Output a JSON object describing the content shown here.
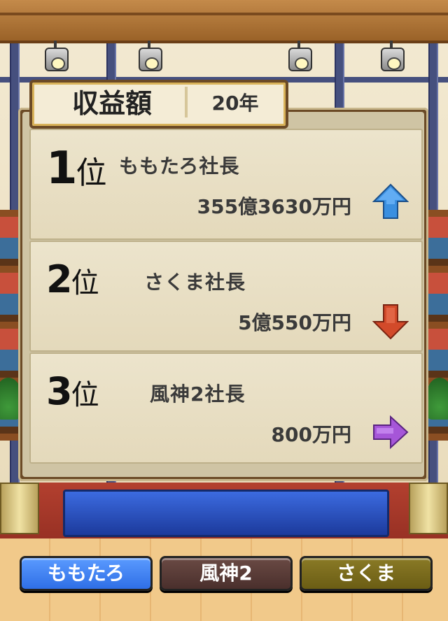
{
  "title": {
    "label": "収益額",
    "period": "20年"
  },
  "rankings": [
    {
      "rank": "1",
      "rank_suffix": "位",
      "name": "ももたろ社長",
      "amount": "355億3630万円",
      "trend": "up",
      "trend_color": "#3a8fe0"
    },
    {
      "rank": "2",
      "rank_suffix": "位",
      "name": "さくま社長",
      "amount": "5億550万円",
      "trend": "down",
      "trend_color": "#d24a2a"
    },
    {
      "rank": "3",
      "rank_suffix": "位",
      "name": "風神2社長",
      "amount": "800万円",
      "trend": "flat",
      "trend_color": "#a656d8"
    }
  ],
  "tabs": [
    {
      "label": "ももたろ",
      "color": "#3f84f2"
    },
    {
      "label": "風神2",
      "color": "#5a3c38"
    },
    {
      "label": "さくま",
      "color": "#7a6b1c"
    }
  ]
}
